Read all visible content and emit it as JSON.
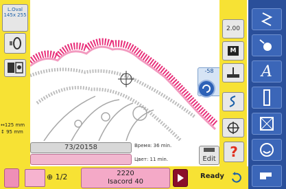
{
  "hoop": {
    "name": "L.Oval",
    "size": "145x 255"
  },
  "design_size": {
    "width": "↔125 mm",
    "height": "↕ 95 mm"
  },
  "speed": {
    "value": "-58"
  },
  "stitch": {
    "count": "73/20158"
  },
  "time": {
    "label": "Время: 36 min."
  },
  "color_info": {
    "label": "Цвет: 11 min."
  },
  "edit": {
    "label": "Edit"
  },
  "help": {
    "label": "?"
  },
  "color_counter": {
    "label": "1/2"
  },
  "thread": {
    "number": "2220",
    "name": "Isacord 40"
  },
  "status": {
    "ready": "Ready"
  },
  "toolbar": {
    "tension_label": "2.00",
    "monochrome_label": "M"
  },
  "colors": {
    "panel_yellow": "#f7e234",
    "nav_blue": "#2a4f9a",
    "thread_pink": "#f4a9c7",
    "stitch_pink": "#e8307a"
  }
}
